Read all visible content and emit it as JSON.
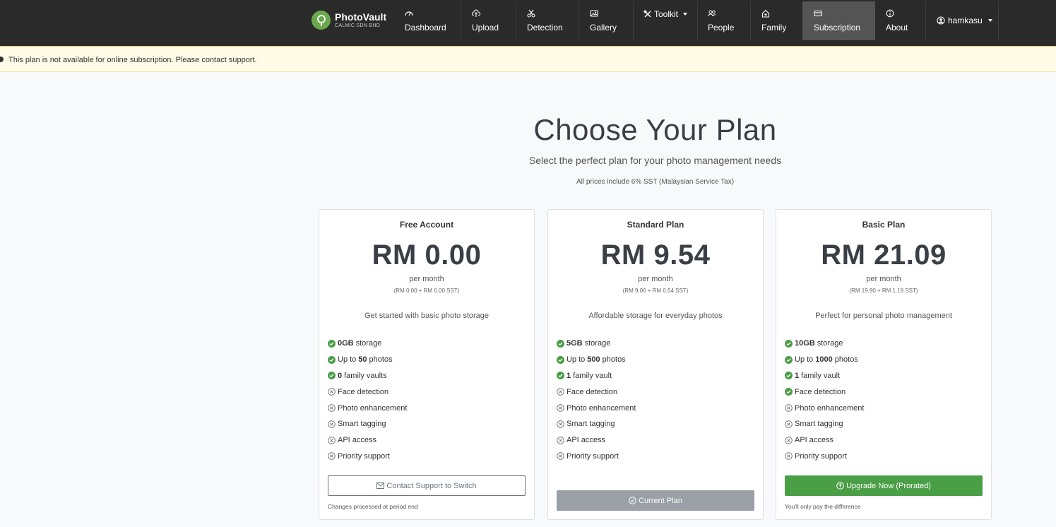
{
  "brand": {
    "name": "PhotoVault",
    "subtitle": "CALMIC SDN BHD"
  },
  "nav": {
    "dashboard": "Dashboard",
    "upload": "Upload",
    "detection": "Detection",
    "gallery": "Gallery",
    "toolkit": "Toolkit",
    "people": "People",
    "family": "Family",
    "subscription": "Subscription",
    "about": "About",
    "user": "hamkasu"
  },
  "alert": {
    "text": "This plan is not available for online subscription. Please contact support."
  },
  "header": {
    "title": "Choose Your Plan",
    "subtitle": "Select the perfect plan for your photo management needs",
    "note": "All prices include 6% SST (Malaysian Service Tax)"
  },
  "plans": [
    {
      "name": "Free Account",
      "price": "RM 0.00",
      "period": "per month",
      "breakdown": "(RM 0.00 + RM 0.00 SST)",
      "description": "Get started with basic photo storage",
      "features": [
        {
          "bold": "0GB",
          "text": "storage",
          "included": true
        },
        {
          "pre": "Up to",
          "bold": "50",
          "text": "photos",
          "included": true
        },
        {
          "bold": "0",
          "text": "family vaults",
          "included": true
        },
        {
          "text": "Face detection",
          "included": false
        },
        {
          "text": "Photo enhancement",
          "included": false
        },
        {
          "text": "Smart tagging",
          "included": false
        },
        {
          "text": "API access",
          "included": false
        },
        {
          "text": "Priority support",
          "included": false
        }
      ],
      "button": "Contact Support to Switch",
      "footnote": "Changes processed at period end"
    },
    {
      "name": "Standard Plan",
      "price": "RM 9.54",
      "period": "per month",
      "breakdown": "(RM 9.00 + RM 0.54 SST)",
      "description": "Affordable storage for everyday photos",
      "features": [
        {
          "bold": "5GB",
          "text": "storage",
          "included": true
        },
        {
          "pre": "Up to",
          "bold": "500",
          "text": "photos",
          "included": true
        },
        {
          "bold": "1",
          "text": "family vault",
          "included": true
        },
        {
          "text": "Face detection",
          "included": false
        },
        {
          "text": "Photo enhancement",
          "included": false
        },
        {
          "text": "Smart tagging",
          "included": false
        },
        {
          "text": "API access",
          "included": false
        },
        {
          "text": "Priority support",
          "included": false
        }
      ],
      "button": "Current Plan",
      "footnote": ""
    },
    {
      "name": "Basic Plan",
      "price": "RM 21.09",
      "period": "per month",
      "breakdown": "(RM 19.90 + RM 1.19 SST)",
      "description": "Perfect for personal photo management",
      "features": [
        {
          "bold": "10GB",
          "text": "storage",
          "included": true
        },
        {
          "pre": "Up to",
          "bold": "1000",
          "text": "photos",
          "included": true
        },
        {
          "bold": "1",
          "text": "family vault",
          "included": true
        },
        {
          "text": "Face detection",
          "included": true
        },
        {
          "text": "Photo enhancement",
          "included": false
        },
        {
          "text": "Smart tagging",
          "included": false
        },
        {
          "text": "API access",
          "included": false
        },
        {
          "text": "Priority support",
          "included": false
        }
      ],
      "button": "Upgrade Now (Prorated)",
      "footnote": "You'll only pay the difference"
    }
  ],
  "colors": {
    "navbar": "#2a2a2a",
    "success": "#4a9e46",
    "alert_bg": "#fffbe6"
  }
}
